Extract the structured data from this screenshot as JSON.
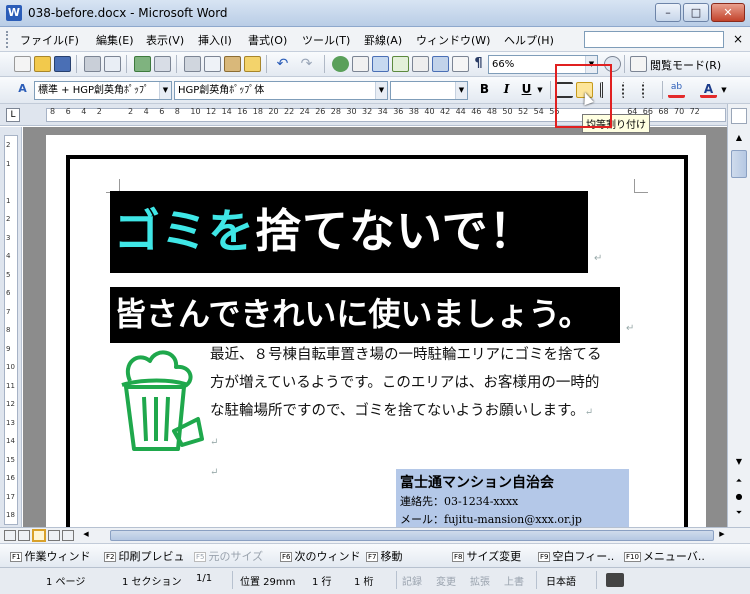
{
  "window": {
    "title": "038-before.docx - Microsoft Word",
    "icon": "word-w-icon",
    "min": "–",
    "max": "□",
    "close": "✕"
  },
  "menu": {
    "items": [
      "ファイル(F)",
      "編集(E)",
      "表示(V)",
      "挿入(I)",
      "書式(O)",
      "ツール(T)",
      "罫線(A)",
      "ウィンドウ(W)",
      "ヘルプ(H)"
    ],
    "search_box": "",
    "close_doc": "×"
  },
  "toolbar": {
    "zoom": "66%",
    "read_mode": "閲覧モード(R)",
    "style": "標準 + HGP創英角ﾎﾟｯﾌﾟ",
    "font": "HGP創英角ﾎﾟｯﾌﾟ体",
    "size": "",
    "bold": "B",
    "italic": "I",
    "underline": "U",
    "font_color": "A"
  },
  "ruler": {
    "marks": [
      "8",
      "6",
      "4",
      "2",
      "",
      "2",
      "4",
      "6",
      "8",
      "10",
      "12",
      "14",
      "16",
      "18",
      "20",
      "22",
      "24",
      "26",
      "28",
      "30",
      "32",
      "34",
      "36",
      "38",
      "40",
      "42",
      "44",
      "46",
      "48",
      "50",
      "52",
      "54",
      "56",
      "",
      "",
      "",
      "",
      "64",
      "66",
      "68",
      "70",
      "72"
    ],
    "tab_icon": "L"
  },
  "vruler": {
    "marks": [
      "2",
      "1",
      "",
      "1",
      "2",
      "3",
      "4",
      "5",
      "6",
      "7",
      "8",
      "9",
      "10",
      "11",
      "12",
      "13",
      "14",
      "15",
      "16",
      "17",
      "18"
    ]
  },
  "tooltip": "均等割り付け",
  "document": {
    "title_part1": "ゴミを",
    "title_part2": "捨てないで！",
    "subtitle": "皆さんできれいに使いましょう。",
    "body_lines": [
      "最近、８号棟自転車置き場の一時駐輪エリアにゴミを捨てる",
      "方が増えているようです。このエリアは、お客様用の一時的",
      "な駐輪場所ですので、ゴミを捨てないようお願いします。"
    ],
    "paragraph_mark": "↵",
    "contact_title": "富士通マンション自治会",
    "contact_phone": "連絡先：03-1234-xxxx",
    "contact_mail": "メール：fujitu-mansion@xxx.or.jp"
  },
  "fkeys": [
    {
      "key": "F1",
      "label": "作業ウィンド",
      "enabled": true
    },
    {
      "key": "F2",
      "label": "印刷プレビュ",
      "enabled": true
    },
    {
      "key": "F5",
      "label": "元のサイズ",
      "enabled": false
    },
    {
      "key": "F6",
      "label": "次のウィンド",
      "enabled": true
    },
    {
      "key": "F7",
      "label": "移動",
      "enabled": true
    },
    {
      "key": "F8",
      "label": "サイズ変更",
      "enabled": true
    },
    {
      "key": "F9",
      "label": "空白フィー..",
      "enabled": true
    },
    {
      "key": "F10",
      "label": "メニューバ..",
      "enabled": true
    }
  ],
  "status": {
    "page": "1 ページ",
    "section": "1 セクション",
    "pages": "1/1",
    "position": "位置  29mm",
    "line": "1 行",
    "column": "1 桁",
    "rec": "記録",
    "trk": "変更",
    "ext": "拡張",
    "ovr": "上書",
    "language": "日本語"
  },
  "colors": {
    "title_cyan": "#3fe6e6",
    "trash_green": "#1fa84c",
    "contact_bg": "#b4c8e8",
    "highlight": "#e02020"
  }
}
